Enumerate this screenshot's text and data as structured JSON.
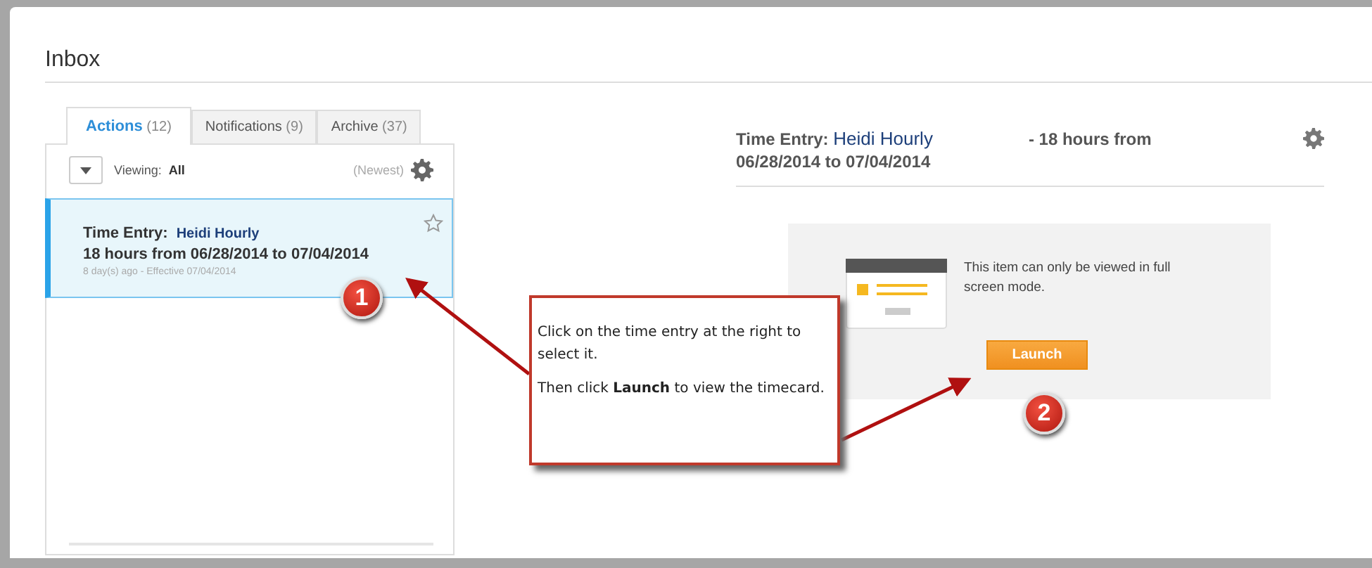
{
  "page": {
    "title": "Inbox"
  },
  "tabs": [
    {
      "label": "Actions",
      "count": "(12)",
      "selected": true
    },
    {
      "label": "Notifications",
      "count": "(9)",
      "selected": false
    },
    {
      "label": "Archive",
      "count": "(37)",
      "selected": false
    }
  ],
  "toolbar": {
    "viewing_label": "Viewing:",
    "viewing_value": "All",
    "sort": "(Newest)"
  },
  "items": [
    {
      "type_label": "Time Entry:",
      "name": "Heidi Hourly",
      "summary": "18 hours from 06/28/2014 to 07/04/2014",
      "meta": "8 day(s) ago - Effective 07/04/2014",
      "selected": true,
      "starred": false
    }
  ],
  "detail": {
    "type_label": "Time Entry:",
    "name": "Heidi Hourly",
    "summary": "- 18 hours from 06/28/2014 to 07/04/2014",
    "message": "This item can only be viewed in full screen mode.",
    "button": "Launch"
  },
  "callout": {
    "line1": "Click on the time entry at the right to select it.",
    "line2": "Then click **Launch** to view the timecard."
  },
  "markers": [
    "1",
    "2"
  ]
}
